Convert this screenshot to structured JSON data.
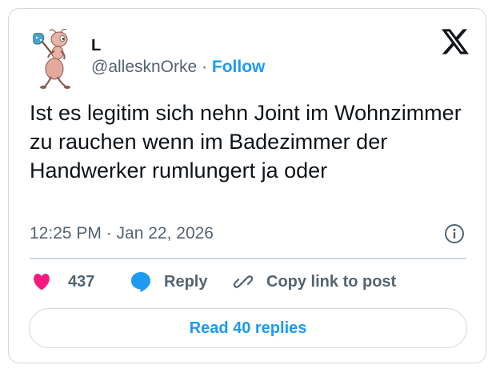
{
  "author": {
    "display_name": "L",
    "handle": "@allesknOrke",
    "separator": "·",
    "follow_label": "Follow",
    "avatar_icon": "ant-with-bindle-icon"
  },
  "platform_icon": "x-logo-icon",
  "tweet": {
    "text": "Ist es legitim sich nehn Joint im Wohnzimmer zu rauchen wenn im Badezimmer der Handwerker rumlungert ja oder",
    "timestamp": "12:25 PM · Jan 22, 2026",
    "info_icon": "info-icon"
  },
  "actions": {
    "like_count": "437",
    "like_icon": "heart-icon",
    "reply_label": "Reply",
    "reply_icon": "speech-bubble-icon",
    "copy_label": "Copy link to post",
    "copy_icon": "link-icon"
  },
  "read_replies_label": "Read 40 replies",
  "colors": {
    "accent": "#1d9bf0",
    "like": "#f91880",
    "text": "#0f1419",
    "muted": "#536471",
    "border": "#cfd9de"
  }
}
